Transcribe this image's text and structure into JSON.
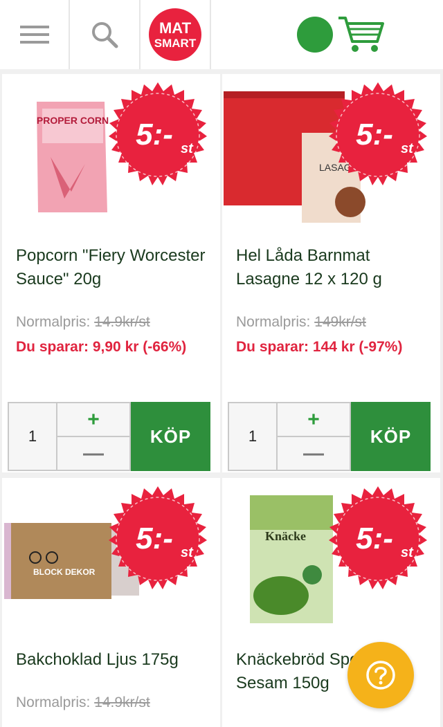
{
  "header": {
    "menu_icon": "hamburger-menu-icon",
    "search_icon": "search-icon",
    "logo_text_line1": "MAT",
    "logo_text_line2": "SMART",
    "cart_icon": "shopping-cart-icon",
    "status_color": "#2e9c3c"
  },
  "badge": {
    "price": "5:-",
    "unit": "st",
    "color": "#e8223e"
  },
  "products": [
    {
      "name": "Popcorn \"Fiery Worcester Sauce\" 20g",
      "normal_label": "Normalpris: ",
      "normal_price": "14.9kr/st",
      "save_text": "Du sparar: 9,90 kr (-66%)",
      "quantity": "1",
      "buy_label": "KÖP",
      "image_text": "PROPER CORN"
    },
    {
      "name": "Hel Låda Barnmat Lasagne 12 x 120 g",
      "normal_label": "Normalpris: ",
      "normal_price": "149kr/st",
      "save_text": "Du sparar: 144 kr (-97%)",
      "quantity": "1",
      "buy_label": "KÖP",
      "image_text": "LASAGNE"
    },
    {
      "name": "Bakchoklad Ljus 175g",
      "normal_label": "Normalpris: ",
      "normal_price": "14.9kr/st",
      "image_text": "BLOCK DEKOR"
    },
    {
      "name": "Knäckebröd Spenat & Sesam 150g",
      "image_text": "Knäcke"
    }
  ],
  "help_icon": "question-mark-icon",
  "colors": {
    "accent_green": "#2e8f3c",
    "sale_red": "#e0243f",
    "help_yellow": "#f5b21a"
  }
}
